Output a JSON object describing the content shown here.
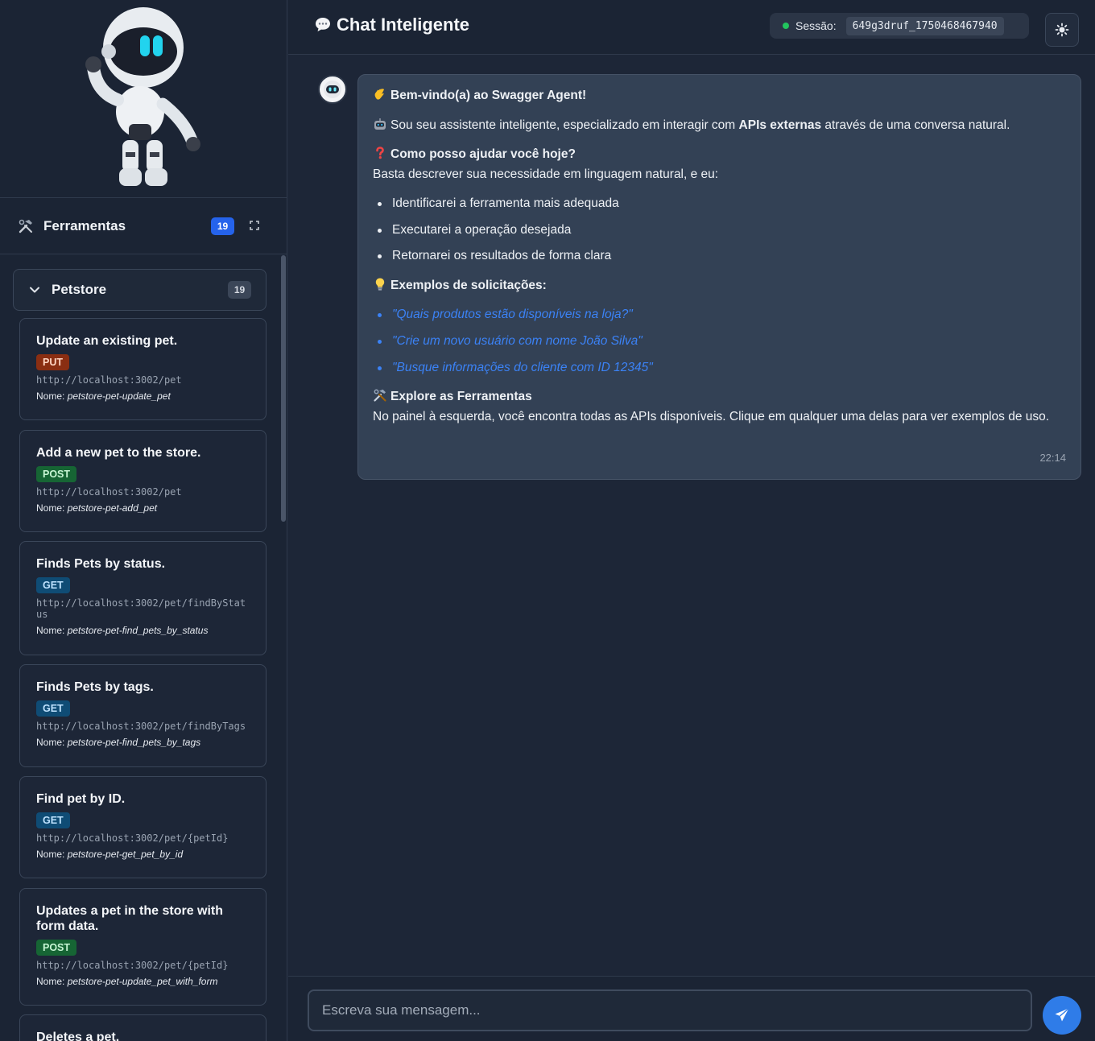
{
  "sidebar": {
    "tools_title": "Ferramentas",
    "tools_count": "19",
    "group": {
      "title": "Petstore",
      "count": "19"
    },
    "tools": [
      {
        "title": "Update an existing pet.",
        "method": "PUT",
        "url": "http://localhost:3002/pet",
        "name_label": "Nome:",
        "name": "petstore-pet-update_pet"
      },
      {
        "title": "Add a new pet to the store.",
        "method": "POST",
        "url": "http://localhost:3002/pet",
        "name_label": "Nome:",
        "name": "petstore-pet-add_pet"
      },
      {
        "title": "Finds Pets by status.",
        "method": "GET",
        "url": "http://localhost:3002/pet/findByStatus",
        "name_label": "Nome:",
        "name": "petstore-pet-find_pets_by_status"
      },
      {
        "title": "Finds Pets by tags.",
        "method": "GET",
        "url": "http://localhost:3002/pet/findByTags",
        "name_label": "Nome:",
        "name": "petstore-pet-find_pets_by_tags"
      },
      {
        "title": "Find pet by ID.",
        "method": "GET",
        "url": "http://localhost:3002/pet/{petId}",
        "name_label": "Nome:",
        "name": "petstore-pet-get_pet_by_id"
      },
      {
        "title": "Updates a pet in the store with form data.",
        "method": "POST",
        "url": "http://localhost:3002/pet/{petId}",
        "name_label": "Nome:",
        "name": "petstore-pet-update_pet_with_form"
      },
      {
        "title": "Deletes a pet."
      }
    ]
  },
  "header": {
    "title": "Chat Inteligente",
    "session_label": "Sessão:",
    "session_id": "649g3druf_1750468467940"
  },
  "message": {
    "welcome": "Bem-vindo(a) ao Swagger Agent!",
    "intro_a": "Sou seu assistente inteligente, especializado em interagir com ",
    "intro_b": "APIs externas",
    "intro_c": " através de uma conversa natural.",
    "help_title": "Como posso ajudar você hoje?",
    "help_text": "Basta descrever sua necessidade em linguagem natural, e eu:",
    "steps": [
      "Identificarei a ferramenta mais adequada",
      "Executarei a operação desejada",
      "Retornarei os resultados de forma clara"
    ],
    "examples_title": "Exemplos de solicitações:",
    "examples": [
      "\"Quais produtos estão disponíveis na loja?\"",
      "\"Crie um novo usuário com nome João Silva\"",
      "\"Busque informações do cliente com ID 12345\""
    ],
    "explore_title": "Explore as Ferramentas",
    "explore_text": "No painel à esquerda, você encontra todas as APIs disponíveis. Clique em qualquer uma delas para ver exemplos de uso.",
    "time": "22:14"
  },
  "input": {
    "placeholder": "Escreva sua mensagem..."
  },
  "colors": {
    "accent": "#2563eb",
    "send": "#2f7ce8",
    "link": "#3b82f6",
    "online": "#22c55e"
  }
}
